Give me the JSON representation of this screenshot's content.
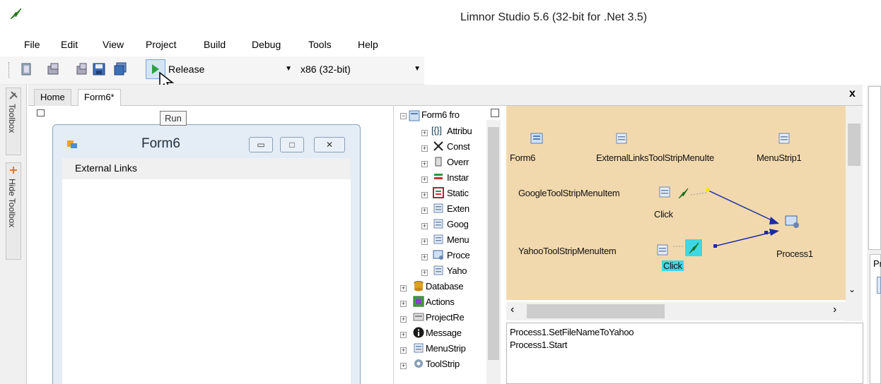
{
  "window": {
    "title": "Limnor Studio 5.6 (32-bit for .Net 3.5)"
  },
  "menu": [
    "File",
    "Edit",
    "View",
    "Project",
    "Build",
    "Debug",
    "Tools",
    "Help"
  ],
  "toolbar": {
    "configuration": "Release",
    "platform": "x86 (32-bit)",
    "run_tooltip": "Run"
  },
  "side_tabs": {
    "toolbox": "Toolbox",
    "hide_toolbox": "Hide Toolbox"
  },
  "doc_tabs": [
    "Home",
    "Form6*"
  ],
  "doc_close": "x",
  "form": {
    "title": "Form6",
    "menu_item": "External Links"
  },
  "tree": {
    "root": "Form6 fro",
    "children": [
      "Attribu",
      "Const",
      "Overr",
      "Instar",
      "Static",
      "Exten",
      "Goog",
      "Menu",
      "Proce",
      "Yaho"
    ],
    "top_items": [
      "Database",
      "Actions",
      "ProjectRe",
      "Message",
      "MenuStrip",
      "ToolStrip"
    ]
  },
  "event_map": {
    "nodes": {
      "form6": "Form6",
      "external_links": "ExternalLinksToolStripMenuIte",
      "menustrip": "MenuStrip1",
      "google": "GoogleToolStripMenuItem",
      "google_click": "Click",
      "yahoo": "YahooToolStripMenuItem",
      "yahoo_click": "Click",
      "process": "Process1"
    }
  },
  "actions": [
    "Process1.SetFileNameToYahoo",
    "Process1.Start"
  ],
  "right_panel": {
    "label": "Pr"
  }
}
